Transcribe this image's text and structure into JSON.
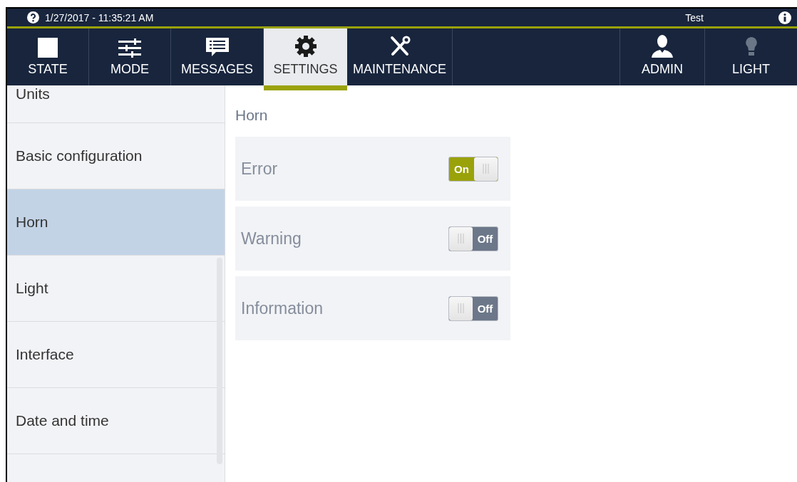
{
  "top_bar": {
    "datetime": "1/27/2017 - 11:35:21 AM",
    "user": "Test"
  },
  "nav_tabs": [
    {
      "label": "STATE",
      "selected": false
    },
    {
      "label": "MODE",
      "selected": false
    },
    {
      "label": "MESSAGES",
      "selected": false
    },
    {
      "label": "SETTINGS",
      "selected": true
    },
    {
      "label": "MAINTENANCE",
      "selected": false
    }
  ],
  "nav_right": [
    {
      "label": "ADMIN"
    },
    {
      "label": "LIGHT"
    }
  ],
  "sidebar": {
    "items": [
      {
        "label": "Units",
        "selected": false
      },
      {
        "label": "Basic configuration",
        "selected": false
      },
      {
        "label": "Horn",
        "selected": true
      },
      {
        "label": "Light",
        "selected": false
      },
      {
        "label": "Interface",
        "selected": false
      },
      {
        "label": "Date and time",
        "selected": false
      }
    ]
  },
  "panel": {
    "title": "Horn",
    "settings": [
      {
        "label": "Error",
        "on": true,
        "state_text": "On"
      },
      {
        "label": "Warning",
        "on": false,
        "state_text": "Off"
      },
      {
        "label": "Information",
        "on": false,
        "state_text": "Off"
      }
    ]
  }
}
